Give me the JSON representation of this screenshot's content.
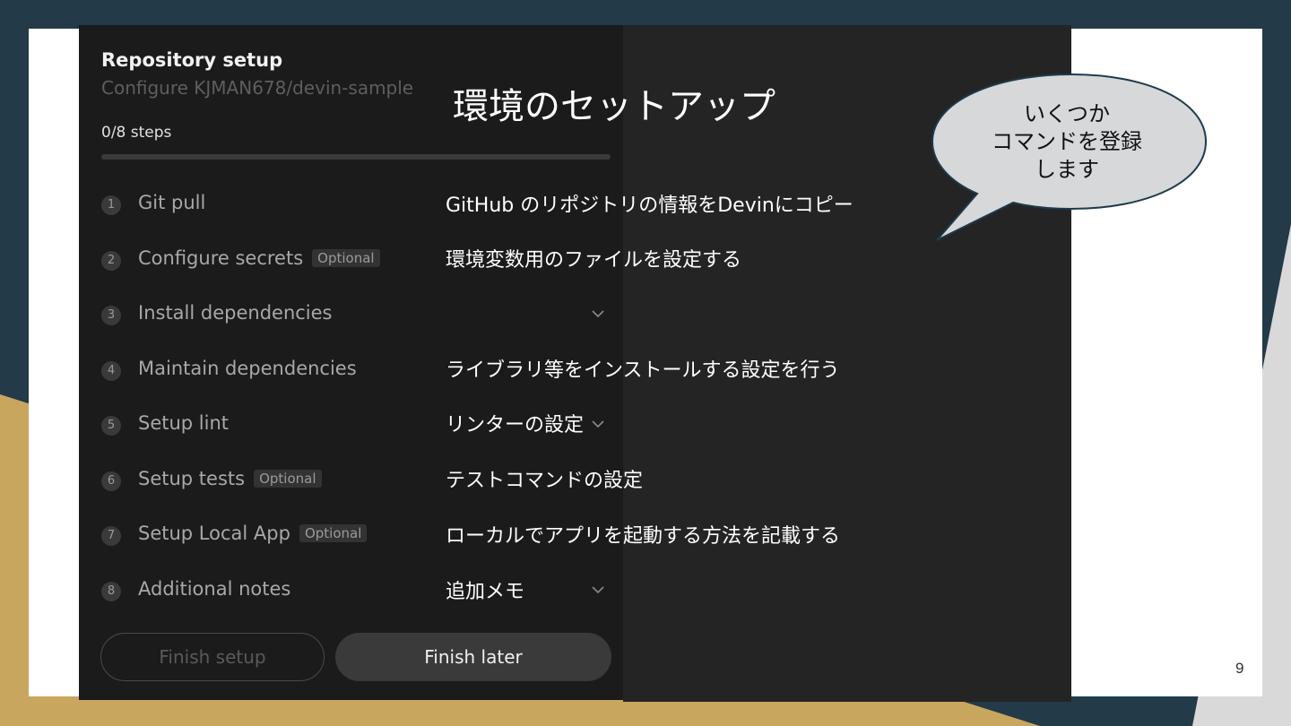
{
  "app": {
    "title": "Repository setup",
    "subtitle": "Configure KJMAN678/devin-sample",
    "steps_count": "0/8 steps",
    "progress": 0.0
  },
  "steps": [
    {
      "num": "1",
      "label": "Git pull",
      "badge": "",
      "chevron": false
    },
    {
      "num": "2",
      "label": "Configure secrets",
      "badge": "Optional",
      "chevron": false
    },
    {
      "num": "3",
      "label": "Install dependencies",
      "badge": "",
      "chevron": true
    },
    {
      "num": "4",
      "label": "Maintain dependencies",
      "badge": "",
      "chevron": false
    },
    {
      "num": "5",
      "label": "Setup lint",
      "badge": "",
      "chevron": true
    },
    {
      "num": "6",
      "label": "Setup tests",
      "badge": "Optional",
      "chevron": false
    },
    {
      "num": "7",
      "label": "Setup Local App",
      "badge": "Optional",
      "chevron": false
    },
    {
      "num": "8",
      "label": "Additional notes",
      "badge": "",
      "chevron": true
    }
  ],
  "buttons": {
    "finish_setup": "Finish setup",
    "finish_later": "Finish later"
  },
  "slide": {
    "heading": "環境のセットアップ",
    "descriptions": [
      "GitHub のリポジトリの情報をDevinにコピー",
      "環境変数用のファイルを設定する",
      "",
      "ライブラリ等をインストールする設定を行う",
      "リンターの設定",
      "テストコマンドの設定",
      "ローカルでアプリを起動する方法を記載する",
      "追加メモ"
    ],
    "bubble_lines": [
      "いくつか",
      "コマンドを登録",
      "します"
    ],
    "page_number": "9"
  },
  "colors": {
    "background": "#233a48",
    "accent_gold": "#c9a65e",
    "panel": "#1b1b1b",
    "overlay": "#242424",
    "bubble_fill": "#d6d8da"
  },
  "icons": {
    "chevron": "chevron-down-icon"
  }
}
